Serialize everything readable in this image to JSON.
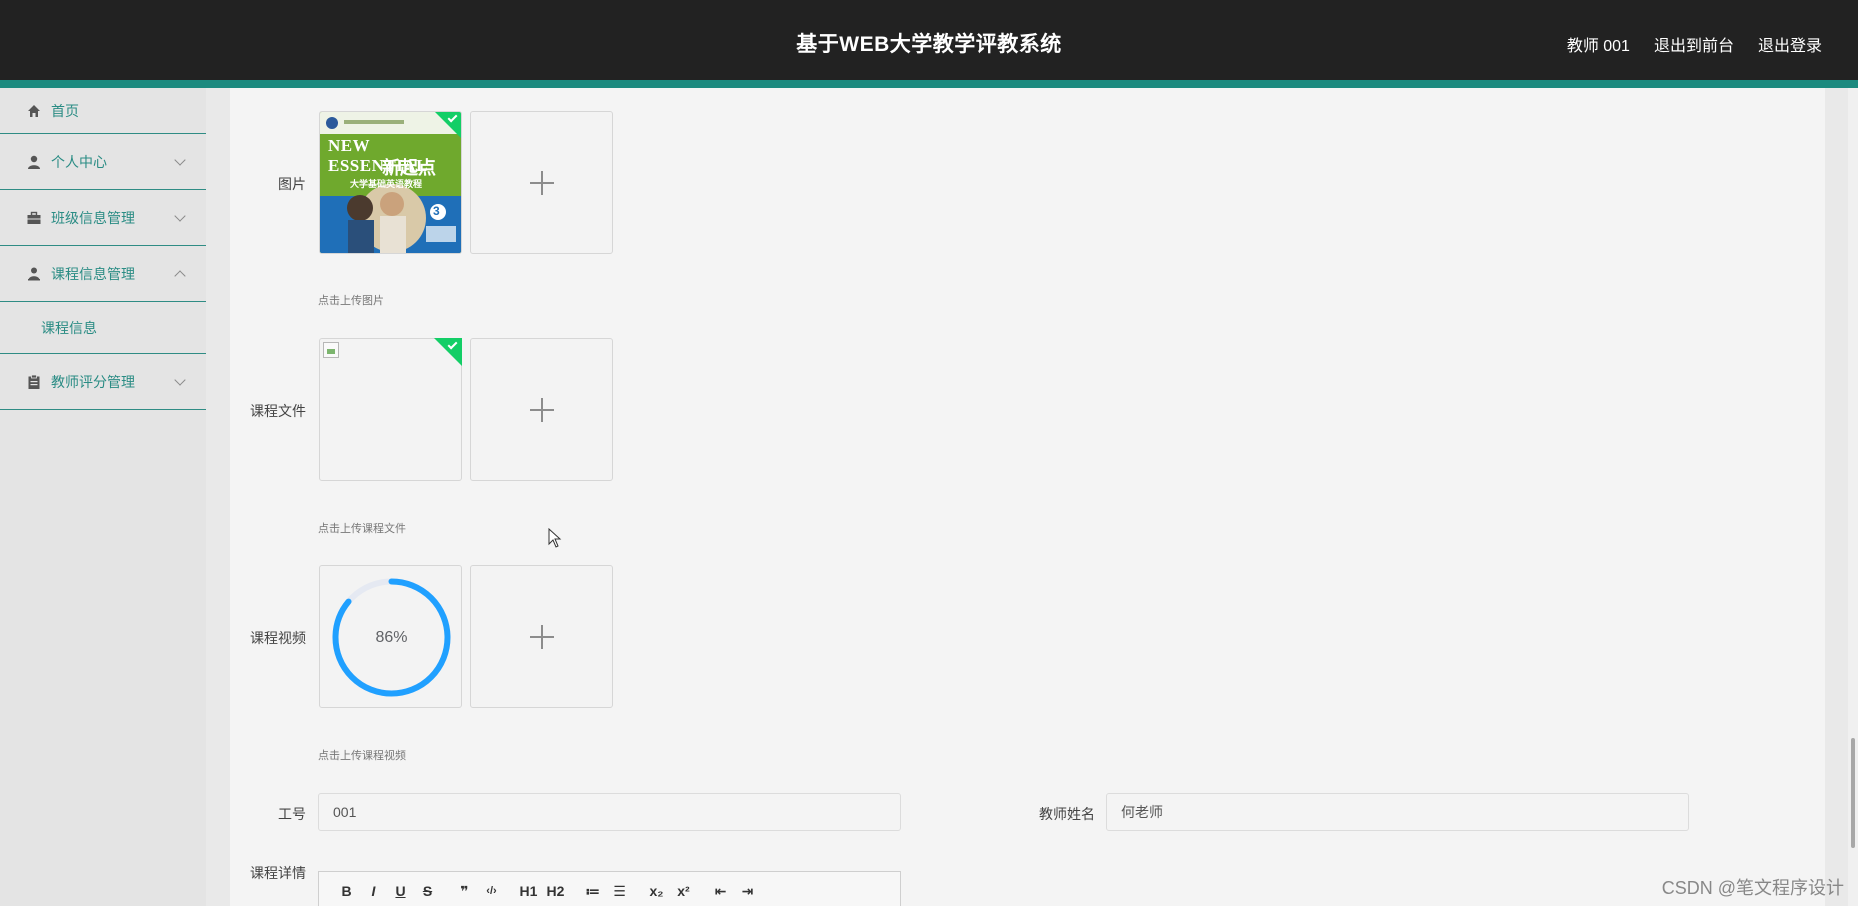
{
  "header": {
    "title": "基于WEB大学教学评教系统",
    "user_label": "教师 001",
    "front_link": "退出到前台",
    "logout_link": "退出登录"
  },
  "sidebar": {
    "items": [
      {
        "label": "首页",
        "icon": "home-icon"
      },
      {
        "label": "个人中心",
        "icon": "user-icon"
      },
      {
        "label": "班级信息管理",
        "icon": "briefcase-icon"
      },
      {
        "label": "课程信息管理",
        "icon": "person-icon"
      },
      {
        "label": "教师评分管理",
        "icon": "clipboard-icon"
      }
    ],
    "sub_item": "课程信息"
  },
  "form": {
    "image": {
      "label": "图片",
      "hint": "点击上传图片"
    },
    "course_file": {
      "label": "课程文件",
      "hint": "点击上传课程文件"
    },
    "course_video": {
      "label": "课程视频",
      "hint": "点击上传课程视频",
      "progress_text": "86%",
      "progress": 0.86
    },
    "work_id": {
      "label": "工号",
      "value": "001"
    },
    "teacher_name": {
      "label": "教师姓名",
      "value": "何老师"
    },
    "course_detail": {
      "label": "课程详情"
    }
  },
  "book_cover": {
    "title_en": "NEW ESSENTIAL",
    "title_cn": "新起点",
    "subtitle": "大学基础英语教程",
    "volume": "3"
  },
  "editor_toolbar": [
    "B",
    "I",
    "U",
    "S",
    "❞",
    "‹/›",
    "H1",
    "H2",
    "≔",
    "☰",
    "x₂",
    "x²",
    "⇤",
    "⇥"
  ],
  "watermark": "CSDN @笔文程序设计",
  "colors": {
    "accent": "#1c8a7f",
    "topbar": "#222222",
    "progress": "#20a0ff",
    "success": "#13ce66"
  }
}
